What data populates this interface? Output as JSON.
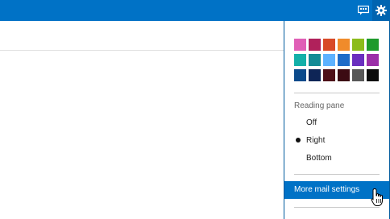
{
  "header": {
    "chat_icon": "chat-bubble-icon",
    "settings_icon": "gear-icon",
    "bar_color": "#0072c6"
  },
  "theme_colors": [
    "#e05fb6",
    "#b0215b",
    "#d84a27",
    "#f08b2b",
    "#8cbc1c",
    "#1e9a2c",
    "#13b0a9",
    "#148b96",
    "#5db2ff",
    "#1e6cc8",
    "#6a2fbf",
    "#9b2fa8",
    "#0b4a8b",
    "#0e2556",
    "#4d1018",
    "#3c0b13",
    "#575757",
    "#0a0a0a"
  ],
  "reading_pane": {
    "label": "Reading pane",
    "options": [
      "Off",
      "Right",
      "Bottom"
    ],
    "selected": "Right"
  },
  "more_mail_settings_label": "More mail settings"
}
